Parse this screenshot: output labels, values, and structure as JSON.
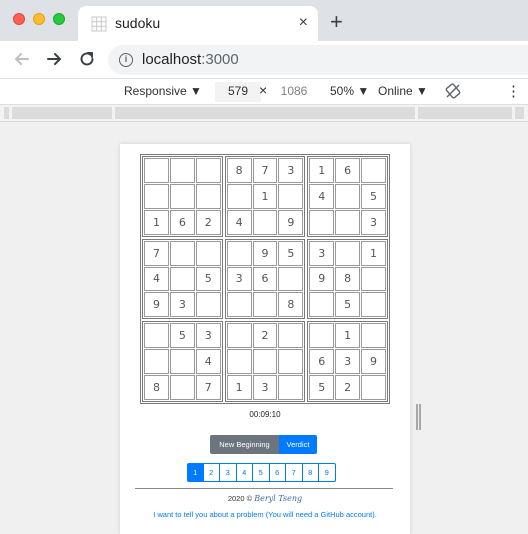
{
  "browser": {
    "tab_title": "sudoku",
    "tab_close": "×",
    "new_tab": "+",
    "url_host": "localhost",
    "url_port": ":3000"
  },
  "devtools": {
    "device": "Responsive ▼",
    "width": "579",
    "times": "×",
    "height": "1086",
    "zoom": "50% ▼",
    "network": "Online ▼",
    "more": "⋮"
  },
  "sudoku": {
    "grid": [
      [
        "",
        "",
        "",
        "8",
        "7",
        "3",
        "1",
        "6",
        ""
      ],
      [
        "",
        "",
        "",
        "",
        "1",
        "",
        "4",
        "",
        "5"
      ],
      [
        "1",
        "6",
        "2",
        "4",
        "",
        "9",
        "",
        "",
        "3"
      ],
      [
        "7",
        "",
        "",
        "",
        "9",
        "5",
        "3",
        "",
        "1"
      ],
      [
        "4",
        "",
        "5",
        "3",
        "6",
        "",
        "9",
        "8",
        ""
      ],
      [
        "9",
        "3",
        "",
        "",
        "",
        "8",
        "",
        "5",
        ""
      ],
      [
        "",
        "5",
        "3",
        "",
        "2",
        "",
        "",
        "1",
        ""
      ],
      [
        "",
        "",
        "4",
        "",
        "",
        "",
        "6",
        "3",
        "9"
      ],
      [
        "8",
        "",
        "7",
        "1",
        "3",
        "",
        "5",
        "2",
        ""
      ]
    ],
    "timer": "00:09:10",
    "new_beginning_label": "New Beginning",
    "verdict_label": "Verdict",
    "pages": [
      "1",
      "2",
      "3",
      "4",
      "5",
      "6",
      "7",
      "8",
      "9"
    ],
    "active_page": "1"
  },
  "footer": {
    "copyright": "2020 ©",
    "author": "Beryl Tseng",
    "report_link": "I want to tell you about a problem (You will need a GitHub account)."
  }
}
